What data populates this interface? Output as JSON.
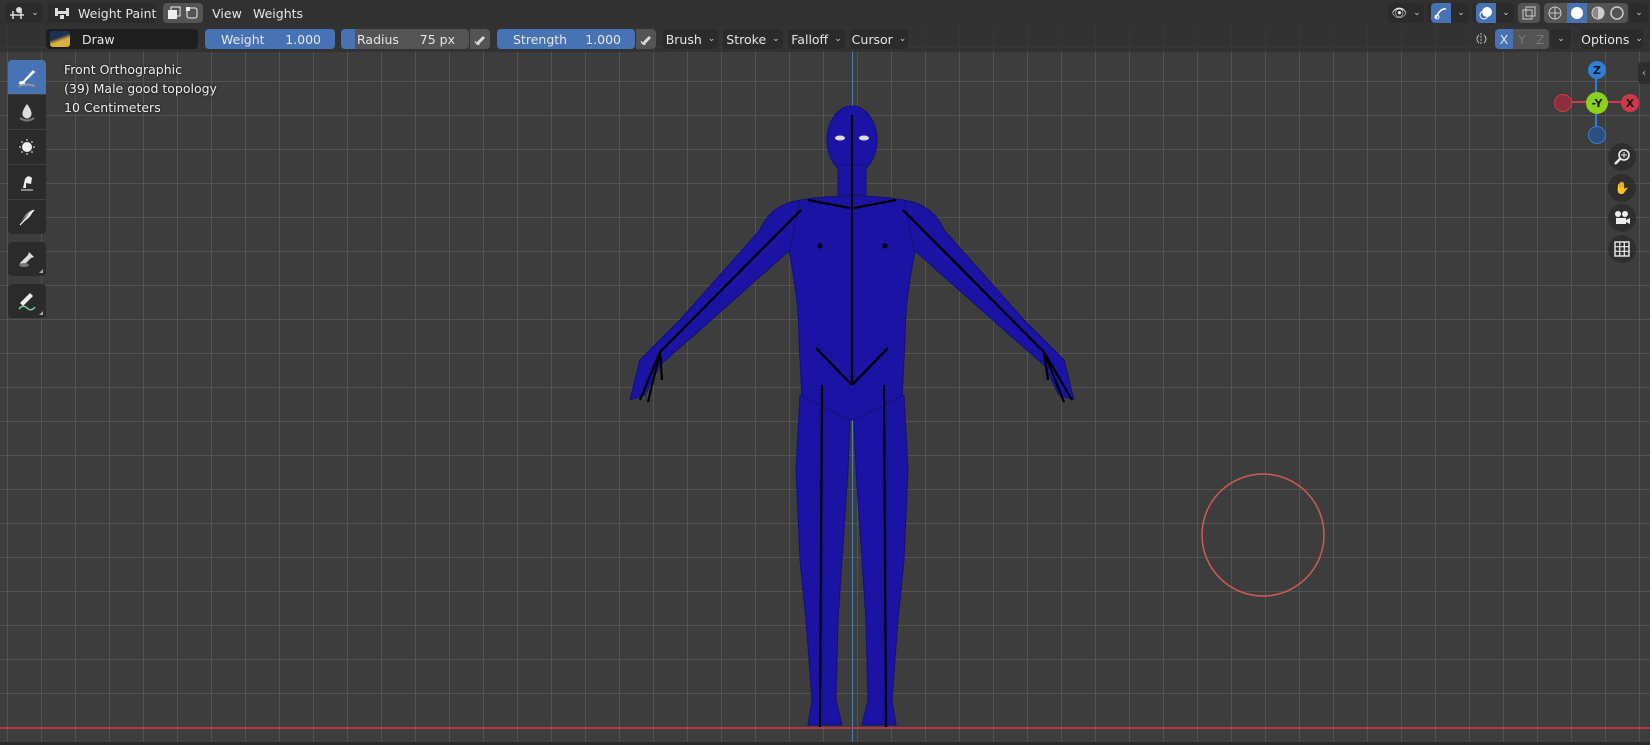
{
  "header": {
    "editor_type_icon": "object-mode-icon",
    "mode": {
      "label": "Weight Paint",
      "icon": "weight-paint-icon"
    },
    "menus": [
      "View",
      "Weights"
    ],
    "right_icons": [
      "visibility-icon",
      "gizmo-icon",
      "overlay-icon",
      "xray-icon"
    ],
    "shading_modes": [
      "wireframe",
      "solid",
      "material",
      "rendered"
    ],
    "active_shading": "solid"
  },
  "tool_settings": {
    "brush_name": "Draw",
    "weight": {
      "label": "Weight",
      "value": "1.000",
      "fraction": 1.0
    },
    "radius": {
      "label": "Radius",
      "value": "75 px"
    },
    "strength": {
      "label": "Strength",
      "value": "1.000",
      "fraction": 1.0
    },
    "dropdowns": [
      "Brush",
      "Stroke",
      "Falloff",
      "Cursor"
    ],
    "mirror": {
      "axes": [
        "X",
        "Y",
        "Z"
      ],
      "active": "X"
    },
    "options_label": "Options"
  },
  "toolbar": {
    "tools": [
      {
        "name": "draw",
        "active": true
      },
      {
        "name": "blur",
        "active": false
      },
      {
        "name": "average",
        "active": false
      },
      {
        "name": "smear",
        "active": false
      },
      {
        "name": "gradient",
        "active": false
      },
      {
        "name": "sample-weight",
        "active": false
      },
      {
        "name": "annotate",
        "active": false
      }
    ]
  },
  "viewport": {
    "view_name": "Front Orthographic",
    "object_info": "(39) Male good topology",
    "scale_info": "10 Centimeters",
    "gizmo": {
      "top": "Z",
      "center": "-Y",
      "right": "X"
    },
    "colors": {
      "weight_zero": "#1a10a0",
      "x_axis": "#d0384c",
      "y_axis": "#8bd11e",
      "z_axis": "#2f7fd8",
      "accent": "#4772b3"
    }
  }
}
